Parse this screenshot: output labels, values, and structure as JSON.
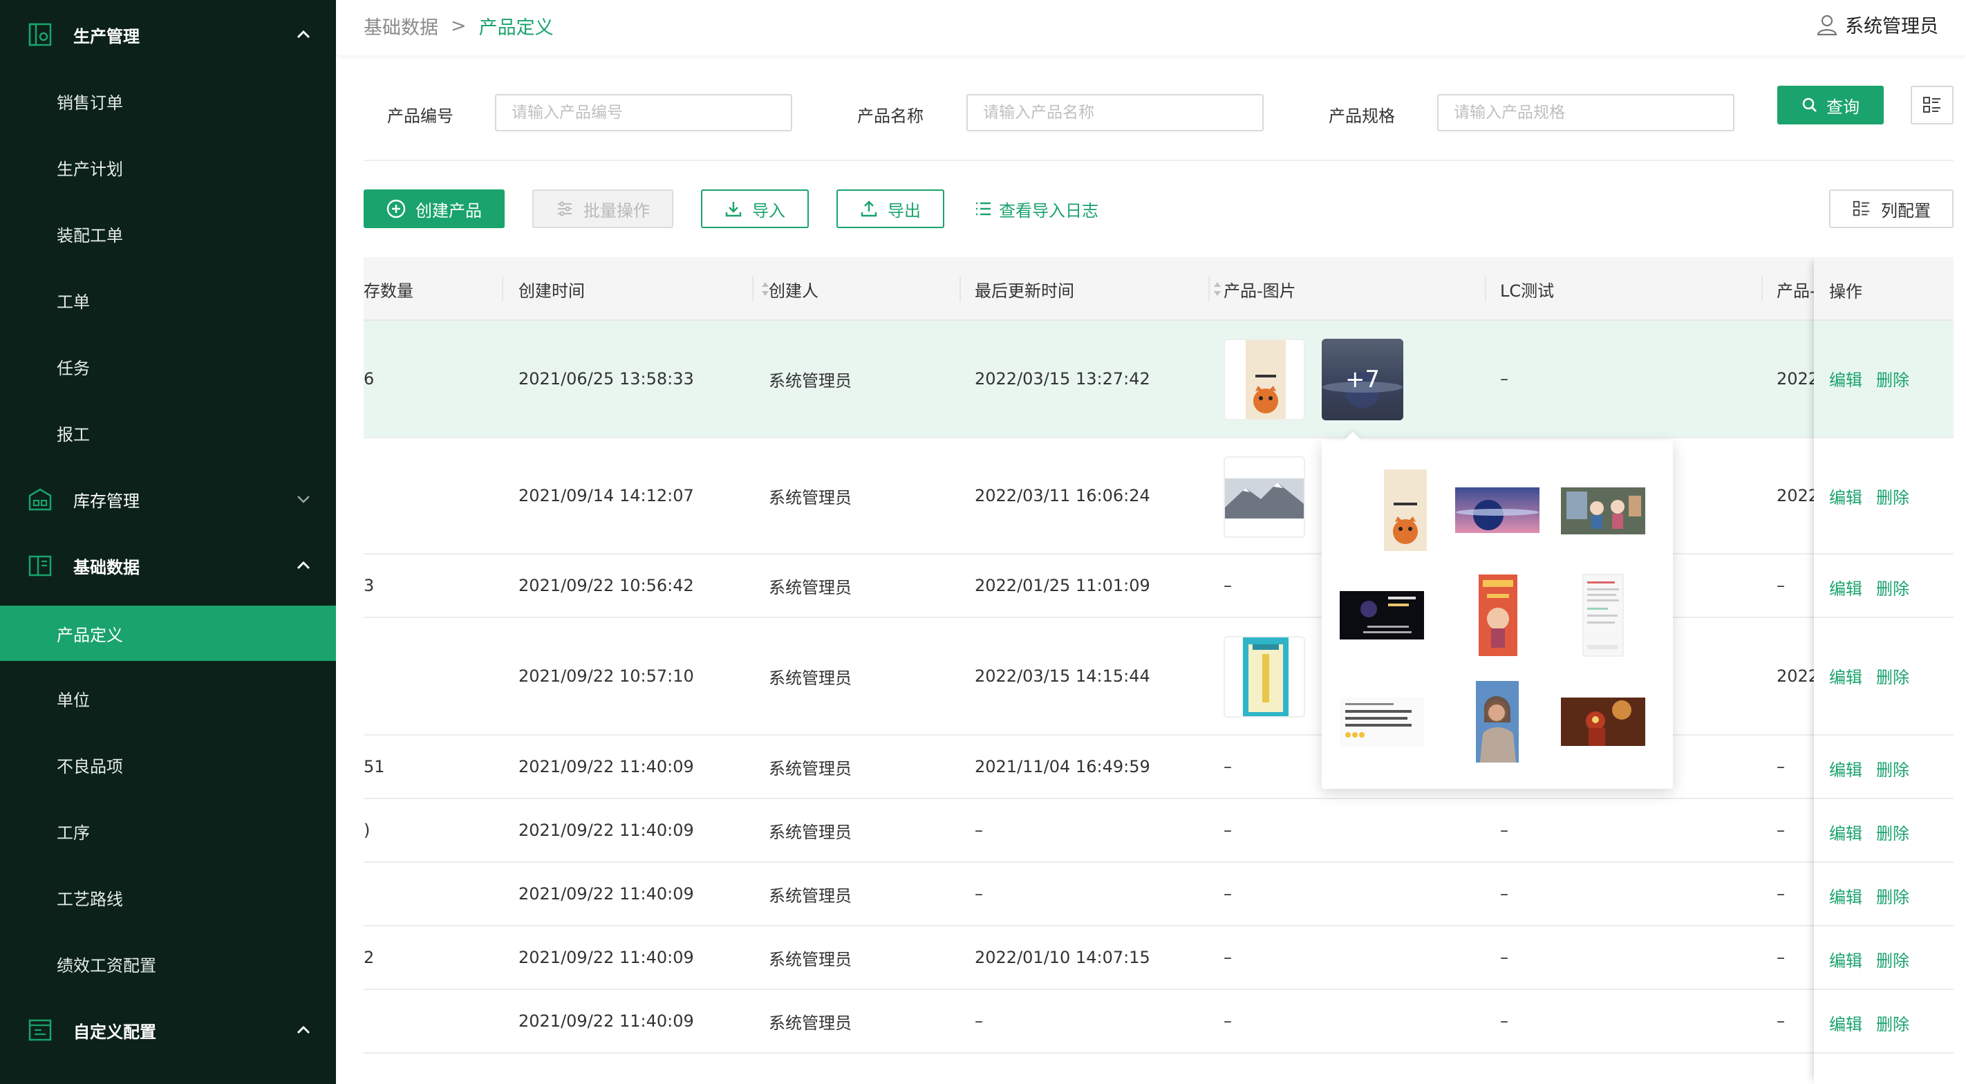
{
  "sidebar": {
    "groups": [
      {
        "label": "生产管理",
        "icon": "production-icon",
        "expanded": true
      },
      {
        "label": "库存管理",
        "icon": "warehouse-icon",
        "expanded": false
      },
      {
        "label": "基础数据",
        "icon": "basic-data-icon",
        "expanded": true
      },
      {
        "label": "自定义配置",
        "icon": "custom-config-icon",
        "expanded": true
      }
    ],
    "production_items": [
      "销售订单",
      "生产计划",
      "装配工单",
      "工单",
      "任务",
      "报工"
    ],
    "basic_items": [
      "产品定义",
      "单位",
      "不良品项",
      "工序",
      "工艺路线",
      "绩效工资配置"
    ],
    "active_item": "产品定义"
  },
  "header": {
    "breadcrumb_parent": "基础数据",
    "breadcrumb_sep": ">",
    "breadcrumb_current": "产品定义",
    "user_name": "系统管理员"
  },
  "filters": {
    "code_label": "产品编号",
    "code_placeholder": "请输入产品编号",
    "name_label": "产品名称",
    "name_placeholder": "请输入产品名称",
    "spec_label": "产品规格",
    "spec_placeholder": "请输入产品规格",
    "query_label": "查询"
  },
  "toolbar": {
    "create_label": "创建产品",
    "batch_label": "批量操作",
    "import_label": "导入",
    "export_label": "导出",
    "import_log_label": "查看导入日志",
    "column_config_label": "列配置"
  },
  "table": {
    "columns": [
      "库存数量",
      "创建时间",
      "创建人",
      "最后更新时间",
      "产品-图片",
      "LC测试",
      "产品-",
      "操作"
    ],
    "column_stock_visible": "存数量",
    "actions": {
      "edit": "编辑",
      "delete": "删除"
    },
    "rows": [
      {
        "stock": "6",
        "created": "2021/06/25 13:58:33",
        "creator": "系统管理员",
        "updated": "2022/03/15 13:27:42",
        "lc": "–",
        "prod": "2022"
      },
      {
        "stock": "",
        "created": "2021/09/14 14:12:07",
        "creator": "系统管理员",
        "updated": "2022/03/11 16:06:24",
        "lc": "",
        "prod": "2022"
      },
      {
        "stock": "3",
        "created": "2021/09/22 10:56:42",
        "creator": "系统管理员",
        "updated": "2022/01/25 11:01:09",
        "image": "–",
        "lc": "",
        "prod": "–"
      },
      {
        "stock": "",
        "created": "2021/09/22 10:57:10",
        "creator": "系统管理员",
        "updated": "2022/03/15 14:15:44",
        "lc": "",
        "prod": "2022"
      },
      {
        "stock": "51",
        "created": "2021/09/22 11:40:09",
        "creator": "系统管理员",
        "updated": "2021/11/04 16:49:59",
        "image": "–",
        "lc": "",
        "prod": "–"
      },
      {
        "stock": ")",
        "created": "2021/09/22 11:40:09",
        "creator": "系统管理员",
        "updated": "–",
        "image": "–",
        "lc": "–",
        "prod": "–"
      },
      {
        "stock": "",
        "created": "2021/09/22 11:40:09",
        "creator": "系统管理员",
        "updated": "–",
        "image": "–",
        "lc": "–",
        "prod": "–"
      },
      {
        "stock": "2",
        "created": "2021/09/22 11:40:09",
        "creator": "系统管理员",
        "updated": "2022/01/10 14:07:15",
        "image": "–",
        "lc": "–",
        "prod": "–"
      },
      {
        "stock": "",
        "created": "2021/09/22 11:40:09",
        "creator": "系统管理员",
        "updated": "–",
        "image": "–",
        "lc": "–",
        "prod": "–"
      }
    ],
    "more_images_badge": "+7"
  },
  "popover": {
    "images": [
      "cat-poster",
      "planet-space",
      "anime-room",
      "dark-text-slide",
      "red-new-year-card",
      "document-screenshot",
      "chinese-text-meme",
      "woman-portrait",
      "iron-man-scene"
    ]
  },
  "colors": {
    "sidebar_bg": "#0b2119",
    "accent": "#1aa36c",
    "highlight_row": "#e9f6f0"
  }
}
